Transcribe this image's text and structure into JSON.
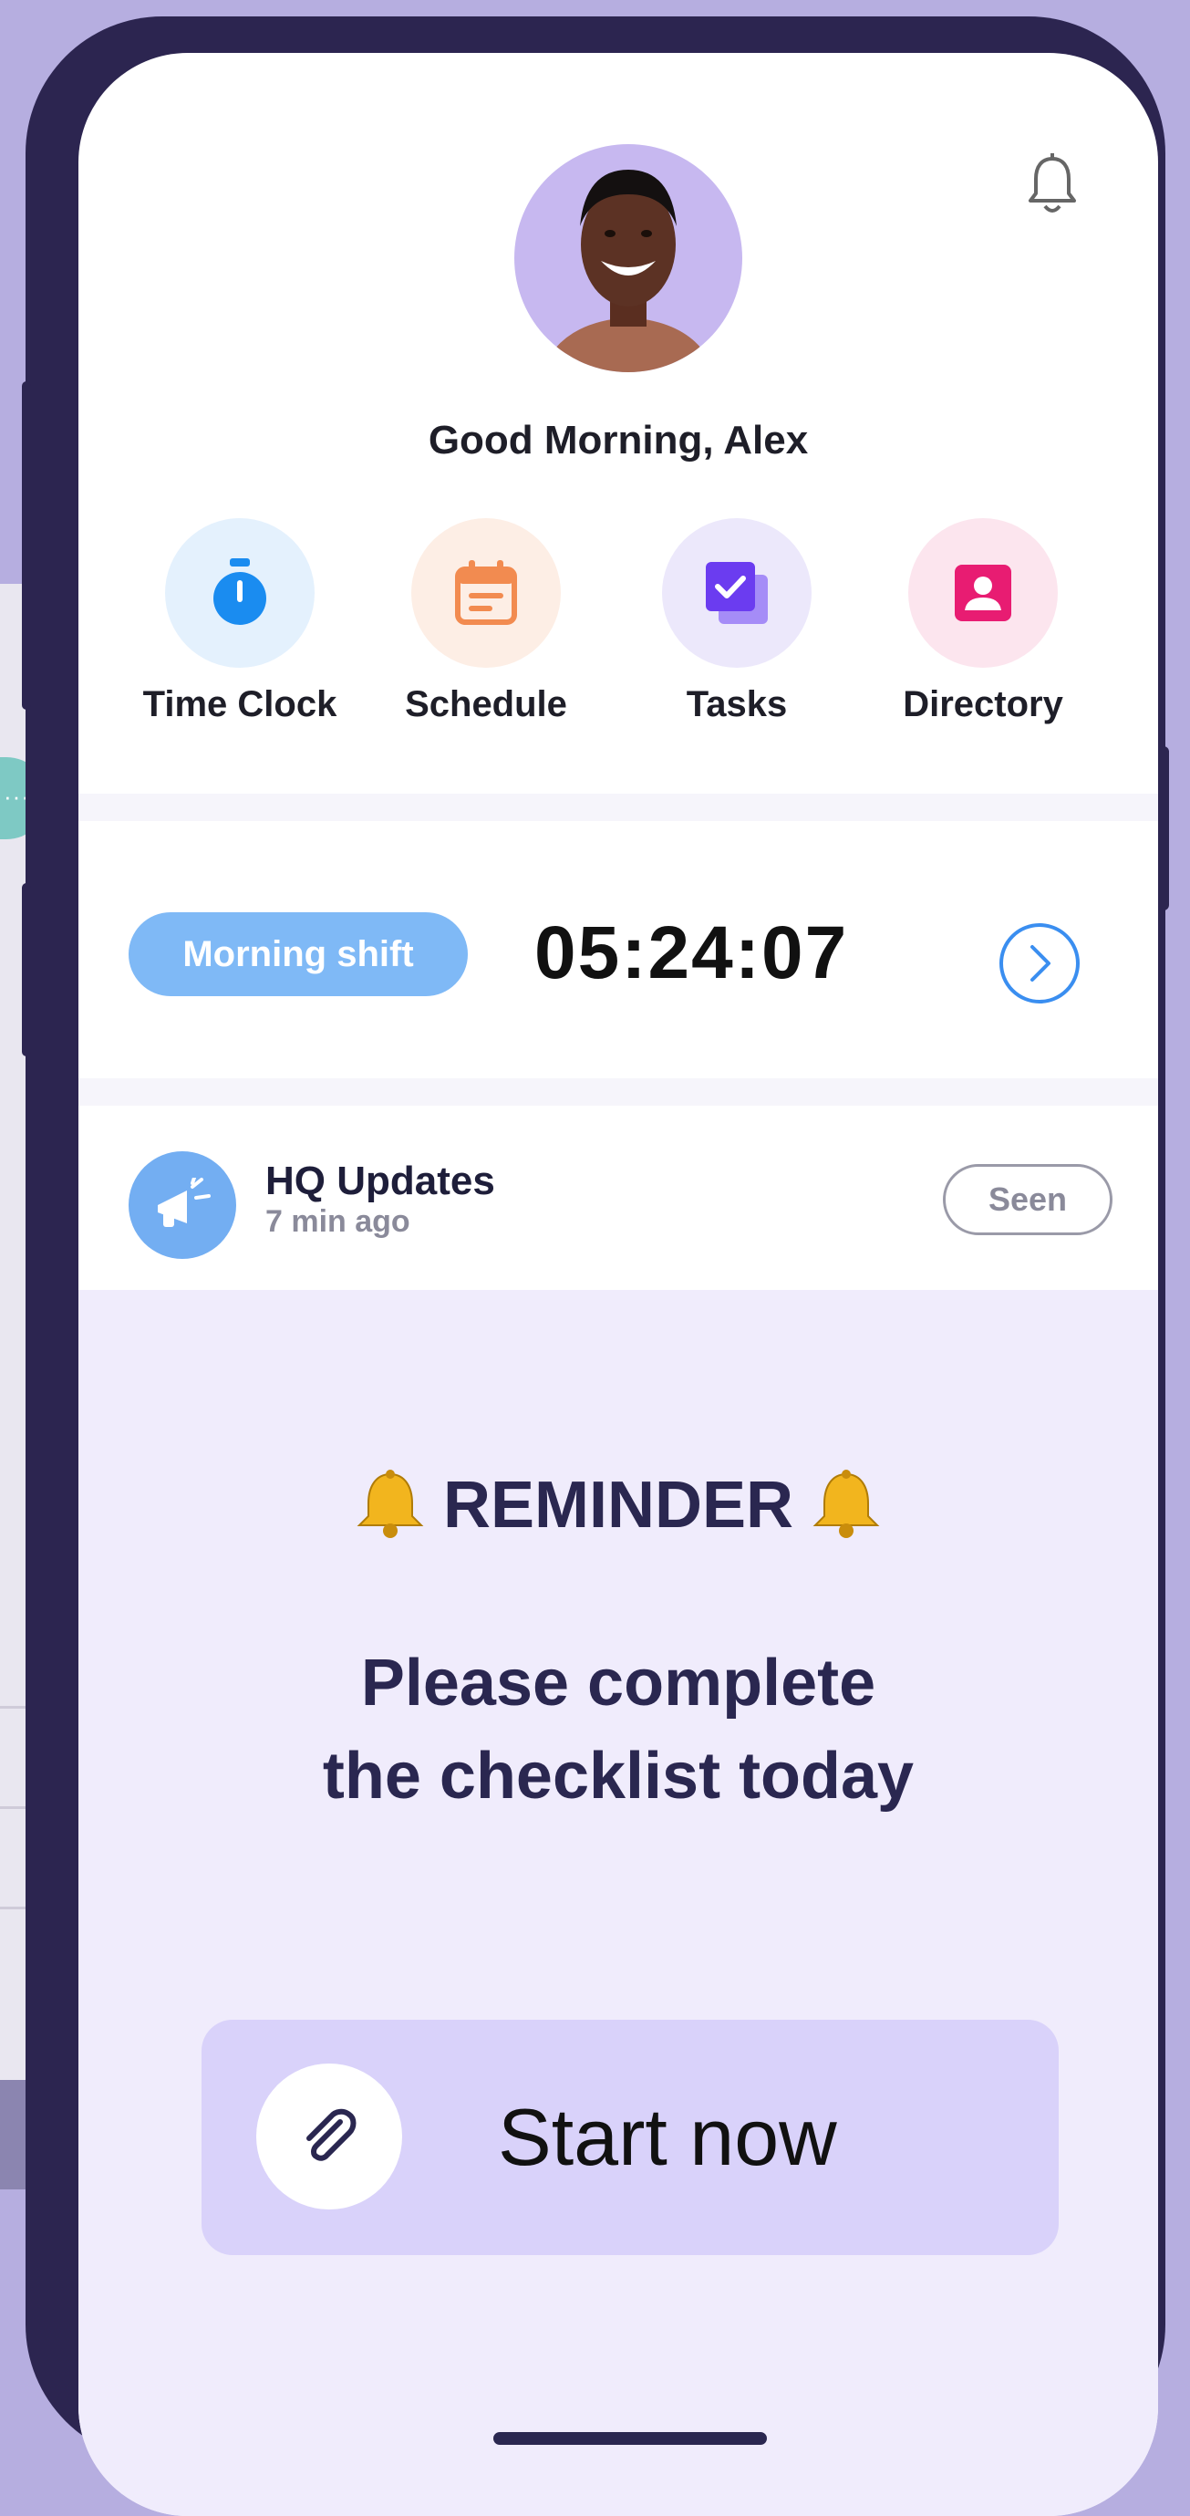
{
  "header": {
    "greeting": "Good Morning, Alex"
  },
  "quick_actions": [
    {
      "label": "Time Clock",
      "icon": "stopwatch-icon",
      "color": "#1a8cf0",
      "bg": "#e4f1fd"
    },
    {
      "label": "Schedule",
      "icon": "calendar-icon",
      "color": "#f28b50",
      "bg": "#fdeee5"
    },
    {
      "label": "Tasks",
      "icon": "task-check-icon",
      "color": "#6b3cf0",
      "bg": "#ece8fb"
    },
    {
      "label": "Directory",
      "icon": "contact-card-icon",
      "color": "#e81c72",
      "bg": "#fce5ee"
    }
  ],
  "shift": {
    "label": "Morning shift",
    "timer": "05:24:07"
  },
  "update": {
    "title": "HQ Updates",
    "time": "7 min ago",
    "seen_label": "Seen"
  },
  "reminder": {
    "title": "REMINDER",
    "message_line1": "Please complete",
    "message_line2": "the checklist today",
    "button_label": "Start now"
  }
}
